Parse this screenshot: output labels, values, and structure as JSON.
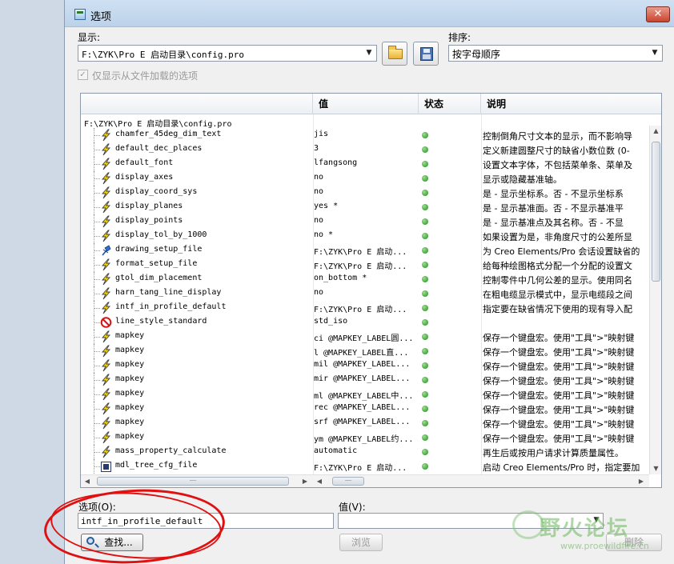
{
  "window": {
    "title": "选项",
    "close_label": "✕"
  },
  "display": {
    "label": "显示:",
    "path": "F:\\ZYK\\Pro E 启动目录\\config.pro"
  },
  "sort": {
    "label": "排序:",
    "value": "按字母顺序"
  },
  "only_loaded": {
    "label": "仅显示从文件加载的选项",
    "checked": true
  },
  "table": {
    "headers": {
      "name": "",
      "value": "值",
      "state": "状态",
      "desc": "说明"
    },
    "root": "F:\\ZYK\\Pro E 启动目录\\config.pro",
    "rows": [
      {
        "icon": "lightning-icon",
        "name": "chamfer_45deg_dim_text",
        "value": "jis",
        "desc": "控制倒角尺寸文本的显示，而不影响导"
      },
      {
        "icon": "lightning-icon",
        "name": "default_dec_places",
        "value": "3",
        "desc": "定义新建圆整尺寸的缺省小数位数 (0-"
      },
      {
        "icon": "lightning-icon",
        "name": "default_font",
        "value": "lfangsong",
        "desc": "设置文本字体，不包括菜单条、菜单及"
      },
      {
        "icon": "lightning-icon",
        "name": "display_axes",
        "value": "no",
        "desc": "显示或隐藏基准轴。"
      },
      {
        "icon": "lightning-icon",
        "name": "display_coord_sys",
        "value": "no",
        "desc": "是 - 显示坐标系。否 - 不显示坐标系"
      },
      {
        "icon": "lightning-icon",
        "name": "display_planes",
        "value": "yes *",
        "desc": "是 - 显示基准面。否 - 不显示基准平"
      },
      {
        "icon": "lightning-icon",
        "name": "display_points",
        "value": "no",
        "desc": "是 - 显示基准点及其名称。否 - 不显"
      },
      {
        "icon": "lightning-icon",
        "name": "display_tol_by_1000",
        "value": "no *",
        "desc": "如果设置为是，非角度尺寸的公差所显"
      },
      {
        "icon": "pin-icon",
        "name": "drawing_setup_file",
        "value": "F:\\ZYK\\Pro E 启动...",
        "desc": "为 Creo Elements/Pro 会话设置缺省的"
      },
      {
        "icon": "lightning-icon",
        "name": "format_setup_file",
        "value": "F:\\ZYK\\Pro E 启动...",
        "desc": "给每种绘图格式分配一个分配的设置文"
      },
      {
        "icon": "lightning-icon",
        "name": "gtol_dim_placement",
        "value": "on_bottom *",
        "desc": "控制零件中几何公差的显示。使用同名"
      },
      {
        "icon": "lightning-icon",
        "name": "harn_tang_line_display",
        "value": "no",
        "desc": "在粗电缆显示模式中，显示电缆段之间"
      },
      {
        "icon": "lightning-icon",
        "name": "intf_in_profile_default",
        "value": "F:\\ZYK\\Pro E 启动...",
        "desc": "指定要在缺省情况下使用的现有导入配"
      },
      {
        "icon": "no-entry-icon",
        "name": "line_style_standard",
        "value": "std_iso",
        "desc": ""
      },
      {
        "icon": "lightning-icon",
        "name": "mapkey",
        "value": "ci @MAPKEY_LABEL圆...",
        "desc": "保存一个键盘宏。使用\"工具\">\"映射键"
      },
      {
        "icon": "lightning-icon",
        "name": "mapkey",
        "value": "l @MAPKEY_LABEL直...",
        "desc": "保存一个键盘宏。使用\"工具\">\"映射键"
      },
      {
        "icon": "lightning-icon",
        "name": "mapkey",
        "value": "mil @MAPKEY_LABEL...",
        "desc": "保存一个键盘宏。使用\"工具\">\"映射键"
      },
      {
        "icon": "lightning-icon",
        "name": "mapkey",
        "value": "mir @MAPKEY_LABEL...",
        "desc": "保存一个键盘宏。使用\"工具\">\"映射键"
      },
      {
        "icon": "lightning-icon",
        "name": "mapkey",
        "value": "ml @MAPKEY_LABEL中...",
        "desc": "保存一个键盘宏。使用\"工具\">\"映射键"
      },
      {
        "icon": "lightning-icon",
        "name": "mapkey",
        "value": "rec @MAPKEY_LABEL...",
        "desc": "保存一个键盘宏。使用\"工具\">\"映射键"
      },
      {
        "icon": "lightning-icon",
        "name": "mapkey",
        "value": "srf @MAPKEY_LABEL...",
        "desc": "保存一个键盘宏。使用\"工具\">\"映射键"
      },
      {
        "icon": "lightning-icon",
        "name": "mapkey",
        "value": "ym @MAPKEY_LABEL约...",
        "desc": "保存一个键盘宏。使用\"工具\">\"映射键"
      },
      {
        "icon": "lightning-icon",
        "name": "mass_property_calculate",
        "value": "automatic",
        "desc": "再生后或按用户请求计算质量属性。"
      },
      {
        "icon": "tree-cfg-icon",
        "name": "mdl_tree_cfg_file",
        "value": "F:\\ZYK\\Pro E 启动...",
        "desc": "启动 Creo Elements/Pro 时，指定要加"
      }
    ]
  },
  "option_field": {
    "label": "选项(O):",
    "value": "intf_in_profile_default"
  },
  "value_field": {
    "label": "值(V):",
    "value": ""
  },
  "buttons": {
    "find": "查找...",
    "browse": "浏览",
    "delete": "删除"
  },
  "watermark": {
    "text": "野火论坛",
    "url": "www.proewildfire.cn"
  },
  "colors": {
    "state_ok": "#1f8a1f",
    "annotation": "#e01010"
  }
}
